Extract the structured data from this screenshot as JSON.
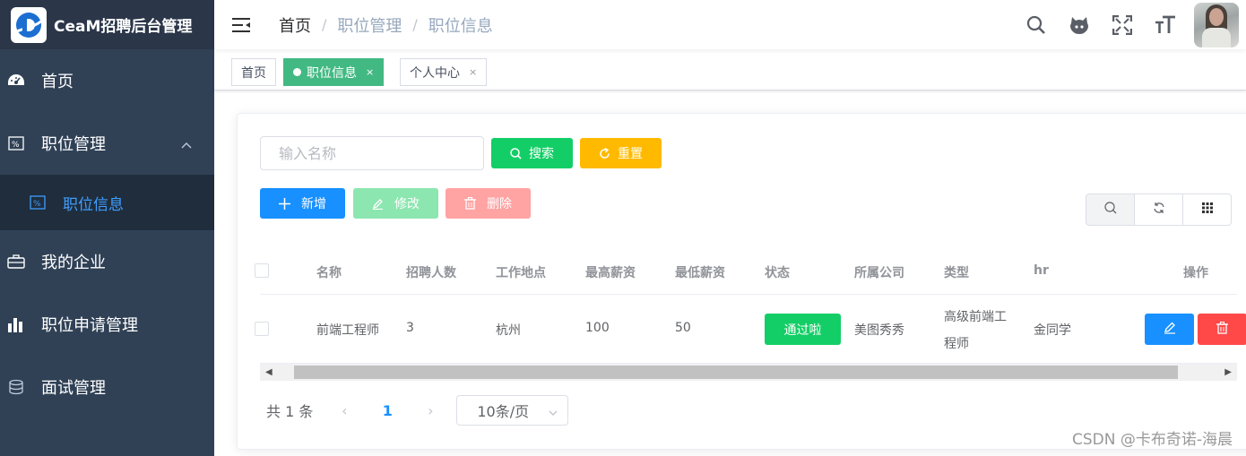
{
  "app": {
    "title": "CeaM招聘后台管理"
  },
  "sidebar": {
    "items": [
      {
        "label": "首页",
        "icon": "dashboard-icon"
      },
      {
        "label": "职位管理",
        "icon": "job-icon",
        "expanded": true
      },
      {
        "label": "职位信息",
        "icon": "job-icon",
        "active": true
      },
      {
        "label": "我的企业",
        "icon": "briefcase-icon"
      },
      {
        "label": "职位申请管理",
        "icon": "bar-chart-icon"
      },
      {
        "label": "面试管理",
        "icon": "database-icon"
      }
    ]
  },
  "breadcrumb": [
    "首页",
    "职位管理",
    "职位信息"
  ],
  "tags": [
    {
      "label": "首页"
    },
    {
      "label": "职位信息",
      "active": true,
      "close": "×"
    },
    {
      "label": "个人中心",
      "close": "×"
    }
  ],
  "search": {
    "placeholder": "输入名称",
    "value": ""
  },
  "buttons": {
    "search": "搜索",
    "reset": "重置",
    "add": "新增",
    "edit": "修改",
    "delete": "删除"
  },
  "table": {
    "columns": [
      "名称",
      "招聘人数",
      "工作地点",
      "最高薪资",
      "最低薪资",
      "状态",
      "所属公司",
      "类型",
      "hr",
      "操作"
    ],
    "rows": [
      {
        "name": "前端工程师",
        "count": "3",
        "location": "杭州",
        "max_salary": "100",
        "min_salary": "50",
        "status": "通过啦",
        "company": "美图秀秀",
        "type_line1": "高级前端工",
        "type_line2": "程师",
        "hr": "金同学"
      }
    ]
  },
  "pagination": {
    "total": "共 1 条",
    "current": "1",
    "page_size": "10条/页"
  },
  "watermark": "CSDN @卡布奇诺-海晨",
  "colors": {
    "sidebar_bg": "#304156",
    "active_menu": "#409eff",
    "tag_active": "#42b983",
    "success": "#13ce66",
    "warning": "#ffba00",
    "primary": "#1890ff",
    "danger": "#ff4949"
  }
}
